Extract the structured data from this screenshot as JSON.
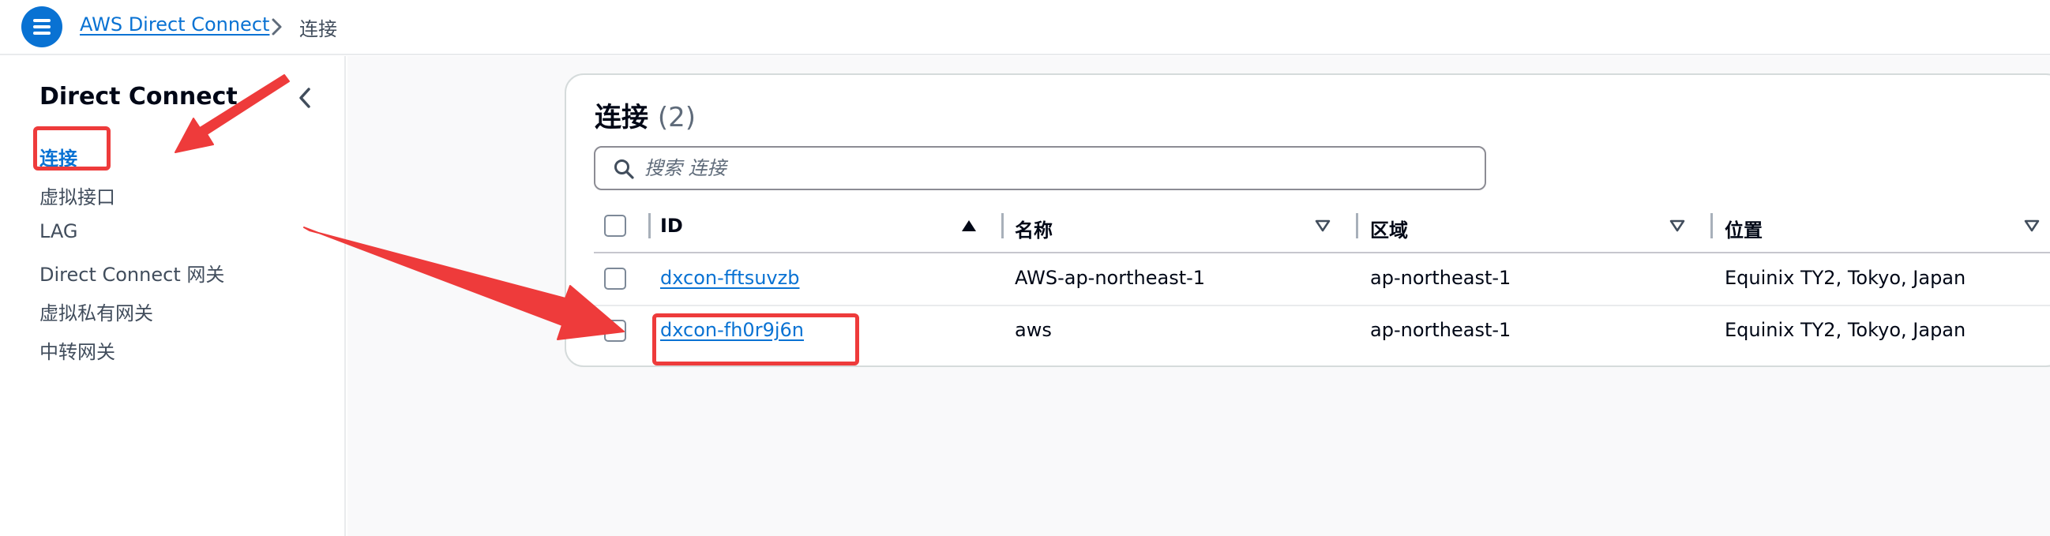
{
  "breadcrumb": {
    "service_link": "AWS Direct Connect",
    "current": "连接"
  },
  "sidenav": {
    "title": "Direct Connect",
    "items": [
      {
        "label": "连接",
        "active": true
      },
      {
        "label": "虚拟接口",
        "active": false
      },
      {
        "label": "LAG",
        "active": false
      },
      {
        "label": "Direct Connect 网关",
        "active": false
      },
      {
        "label": "虚拟私有网关",
        "active": false
      },
      {
        "label": "中转网关",
        "active": false
      }
    ]
  },
  "table": {
    "title": "连接",
    "count": "(2)",
    "search": {
      "placeholder": "搜索 连接",
      "value": ""
    },
    "columns": [
      "ID",
      "名称",
      "区域",
      "位置"
    ],
    "sort": {
      "column": "ID",
      "direction": "ascending"
    },
    "rows": [
      {
        "id": "dxcon-fftsuvzb",
        "name": "AWS-ap-northeast-1",
        "region": "ap-northeast-1",
        "location": "Equinix TY2, Tokyo, Japan",
        "selected": false
      },
      {
        "id": "dxcon-fh0r9j6n",
        "name": "aws",
        "region": "ap-northeast-1",
        "location": "Equinix TY2, Tokyo, Japan",
        "selected": false
      }
    ]
  },
  "colors": {
    "accent": "#0972d3",
    "annotation": "#ee3b3b",
    "text": "#000716",
    "muted": "#414d5c"
  },
  "icons": [
    "menu-icon",
    "chevron-right-icon",
    "chevron-left-icon",
    "search-icon",
    "sort-ascending-icon",
    "sort-descending-icon"
  ]
}
